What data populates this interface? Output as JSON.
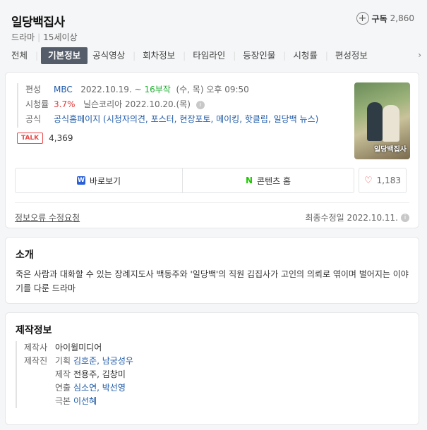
{
  "header": {
    "title": "일당백집사",
    "genre": "드라마",
    "rating": "15세이상",
    "subscribe_label": "구독",
    "subscribe_count": "2,860"
  },
  "tabs": [
    "전체",
    "기본정보",
    "공식영상",
    "회차정보",
    "타임라인",
    "등장인물",
    "시청률",
    "편성정보"
  ],
  "active_tab": 1,
  "basic": {
    "broadcast_label": "편성",
    "channel": "MBC",
    "date_range": "2022.10.19. ~",
    "episodes": "16부작",
    "schedule": "(수, 목) 오후 09:50",
    "ratings_label": "시청률",
    "rating_value": "3.7%",
    "rating_source": "닐슨코리아 2022.10.20.(목)",
    "official_label": "공식",
    "official_links": "공식홈페이지 (시청자의견, 포스터, 현장포토, 메이킹, 핫클립, 일당백 뉴스)",
    "talk_badge": "TALK",
    "talk_count": "4,369",
    "poster_title": "일당백집사"
  },
  "actions": {
    "watch": "바로보기",
    "contents_home": "콘텐츠 홈",
    "like_count": "1,183"
  },
  "footer": {
    "report": "정보오류 수정요청",
    "updated": "최종수정일 2022.10.11."
  },
  "intro": {
    "title": "소개",
    "text": "죽은 사람과 대화할 수 있는 장례지도사 백동주와 '일당백'의 직원 김집사가 고인의 의뢰로 엮이며 벌어지는 이야기를 다룬 드라마"
  },
  "production": {
    "title": "제작정보",
    "company_label": "제작사",
    "company": "아이윌미디어",
    "staff_label": "제작진",
    "roles": [
      {
        "role": "기획",
        "names": "김호준, 남궁성우",
        "link": true
      },
      {
        "role": "제작",
        "names": "전용주, 김창미",
        "link": false
      },
      {
        "role": "연출",
        "names": "심소연, 박선영",
        "link": "partial"
      },
      {
        "role": "극본",
        "names": "이선혜",
        "link": true
      }
    ]
  }
}
